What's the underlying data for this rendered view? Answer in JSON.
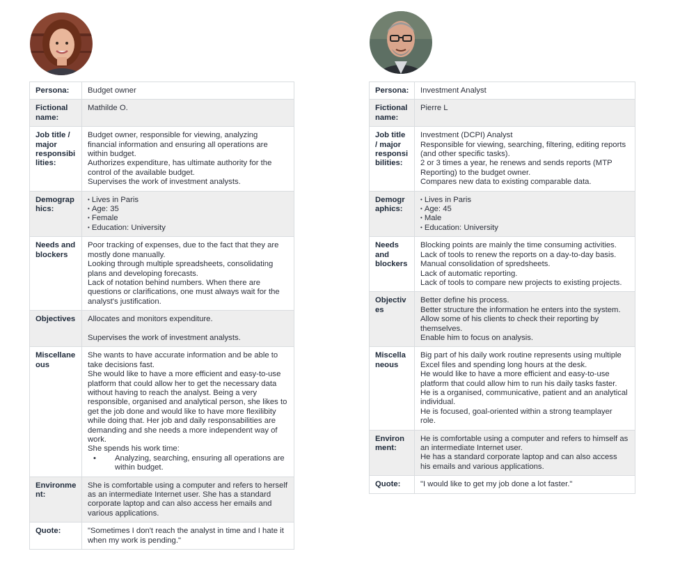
{
  "left": {
    "rows": [
      {
        "label": "Persona:",
        "lines": [
          "Budget owner"
        ]
      },
      {
        "label": "Fictional name:",
        "lines": [
          "Mathilde O."
        ]
      },
      {
        "label": "Job title / major responsibi lities:",
        "lines": [
          "Budget owner, responsible for viewing, analyzing financial information and ensuring all operations are within budget.",
          "Authorizes expenditure, has ultimate authority for the control of the available budget.",
          "Supervises the work of investment analysts."
        ]
      },
      {
        "label": "Demograp hics:",
        "bullets": [
          "Lives in Paris",
          "Age: 35",
          "Female",
          "Education: University"
        ]
      },
      {
        "label": "Needs and blockers",
        "lines": [
          "Poor tracking of expenses, due to the fact that they are mostly done manually.",
          "Looking through multiple spreadsheets, consolidating plans and developing forecasts.",
          "Lack of notation behind numbers. When there are questions or clarifications, one must always wait for the analyst's justification."
        ]
      },
      {
        "label": "Objectives",
        "lines": [
          "Allocates and monitors expenditure.",
          "",
          "Supervises the work of investment analysts."
        ]
      },
      {
        "label": "Miscellane ous",
        "lines": [
          "She wants to have accurate information and be able to take decisions fast.",
          "She would like to have a more efficient and easy-to-use platform that could allow her to get the necessary data without having to reach the analyst. Being a very responsible, organised and analytical person, she likes to get the job done and would like to have more flexilibity while doing that. Her job and daily responsabilities are demanding and she needs a more independent way of work.",
          "She spends his work time:"
        ],
        "sub_bullets": [
          "Analyzing, searching, ensuring all operations are within budget."
        ]
      },
      {
        "label": "Environme nt:",
        "lines": [
          "She is comfortable using a computer and refers to herself as an intermediate Internet user. She has a standard corporate laptop and can also access her emails and various applications."
        ]
      },
      {
        "label": "Quote:",
        "lines": [
          "\"Sometimes I don't reach the analyst in time and I hate it when my work is pending.\""
        ]
      }
    ]
  },
  "right": {
    "rows": [
      {
        "label": "Persona:",
        "lines": [
          "Investment Analyst"
        ]
      },
      {
        "label": "Fictional name:",
        "lines": [
          "Pierre L"
        ]
      },
      {
        "label": "Job title / major responsi bilities:",
        "lines": [
          "Investment (DCPI) Analyst",
          "Responsible for viewing, searching, filtering, editing reports (and other specific tasks).",
          "2 or 3 times a year, he renews and sends reports (MTP Reporting) to the budget owner.",
          "Compares new data to existing comparable data."
        ]
      },
      {
        "label": "Demogr aphics:",
        "bullets": [
          "Lives in Paris",
          "Age: 45",
          "Male",
          "Education: University"
        ]
      },
      {
        "label": "Needs and blockers",
        "lines": [
          "Blocking points are mainly the time consuming activities.",
          "Lack of tools to renew the reports on a day-to-day basis.",
          "Manual consolidation of spredsheets.",
          "Lack of automatic reporting.",
          "Lack of tools to compare new projects to existing projects."
        ]
      },
      {
        "label": "Objectiv es",
        "lines": [
          "Better define his process.",
          "Better structure the information he enters into the system.",
          "Allow some of his clients to check their reporting by themselves.",
          "Enable him to focus on analysis."
        ]
      },
      {
        "label": "Miscella neous",
        "lines": [
          "Big part of his daily work routine represents using multiple Excel files and spending long hours at the desk.",
          "He would like to have a more efficient and easy-to-use platform that could allow him to run his daily tasks faster.",
          "He is a organised, communicative, patient and an analytical individual.",
          "He is focused, goal-oriented within a strong teamplayer role."
        ]
      },
      {
        "label": "Environ ment:",
        "lines": [
          "He is comfortable using a computer and refers to himself as an intermediate Internet user.",
          "He has a standard corporate laptop and can also access his emails and various applications."
        ]
      },
      {
        "label": "Quote:",
        "lines": [
          "\"I would like to get my job done a lot faster.\""
        ]
      }
    ]
  }
}
